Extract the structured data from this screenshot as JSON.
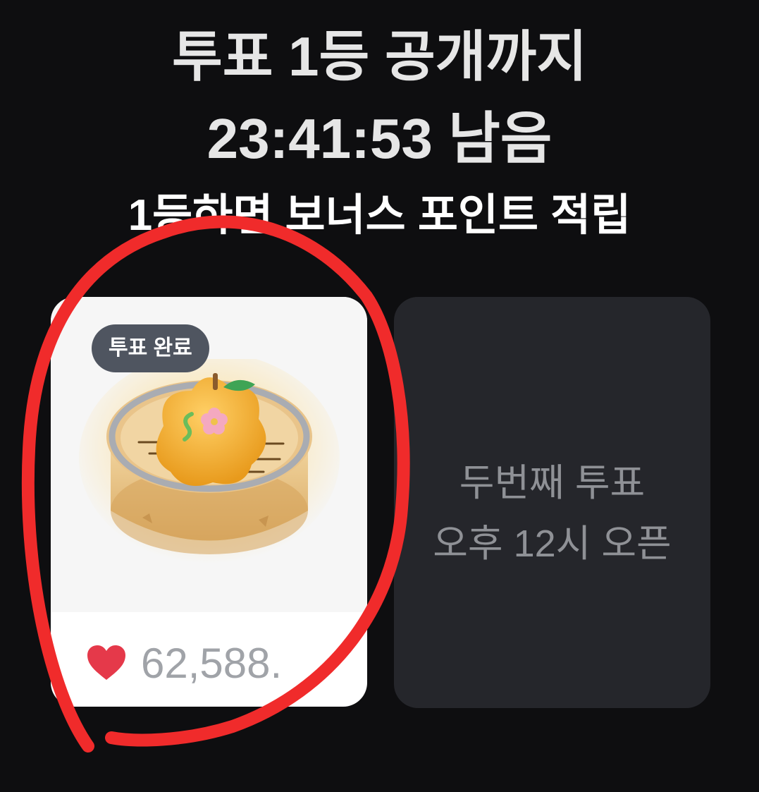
{
  "header": {
    "line1": "투표 1등 공개까지",
    "line2": "23:41:53 남음",
    "line3": "1등하면 보너스 포인트 적립"
  },
  "voted_card": {
    "badge": "투표 완료",
    "like_count": "62,588.",
    "heart_color": "#e5394a",
    "image_icon": "steamed-bun-in-bamboo-steamer"
  },
  "next_card": {
    "line1": "두번째 투표",
    "line2": "오후 12시 오픈"
  },
  "annotation": {
    "color": "#f02b2b",
    "shape": "hand-drawn-circle"
  }
}
